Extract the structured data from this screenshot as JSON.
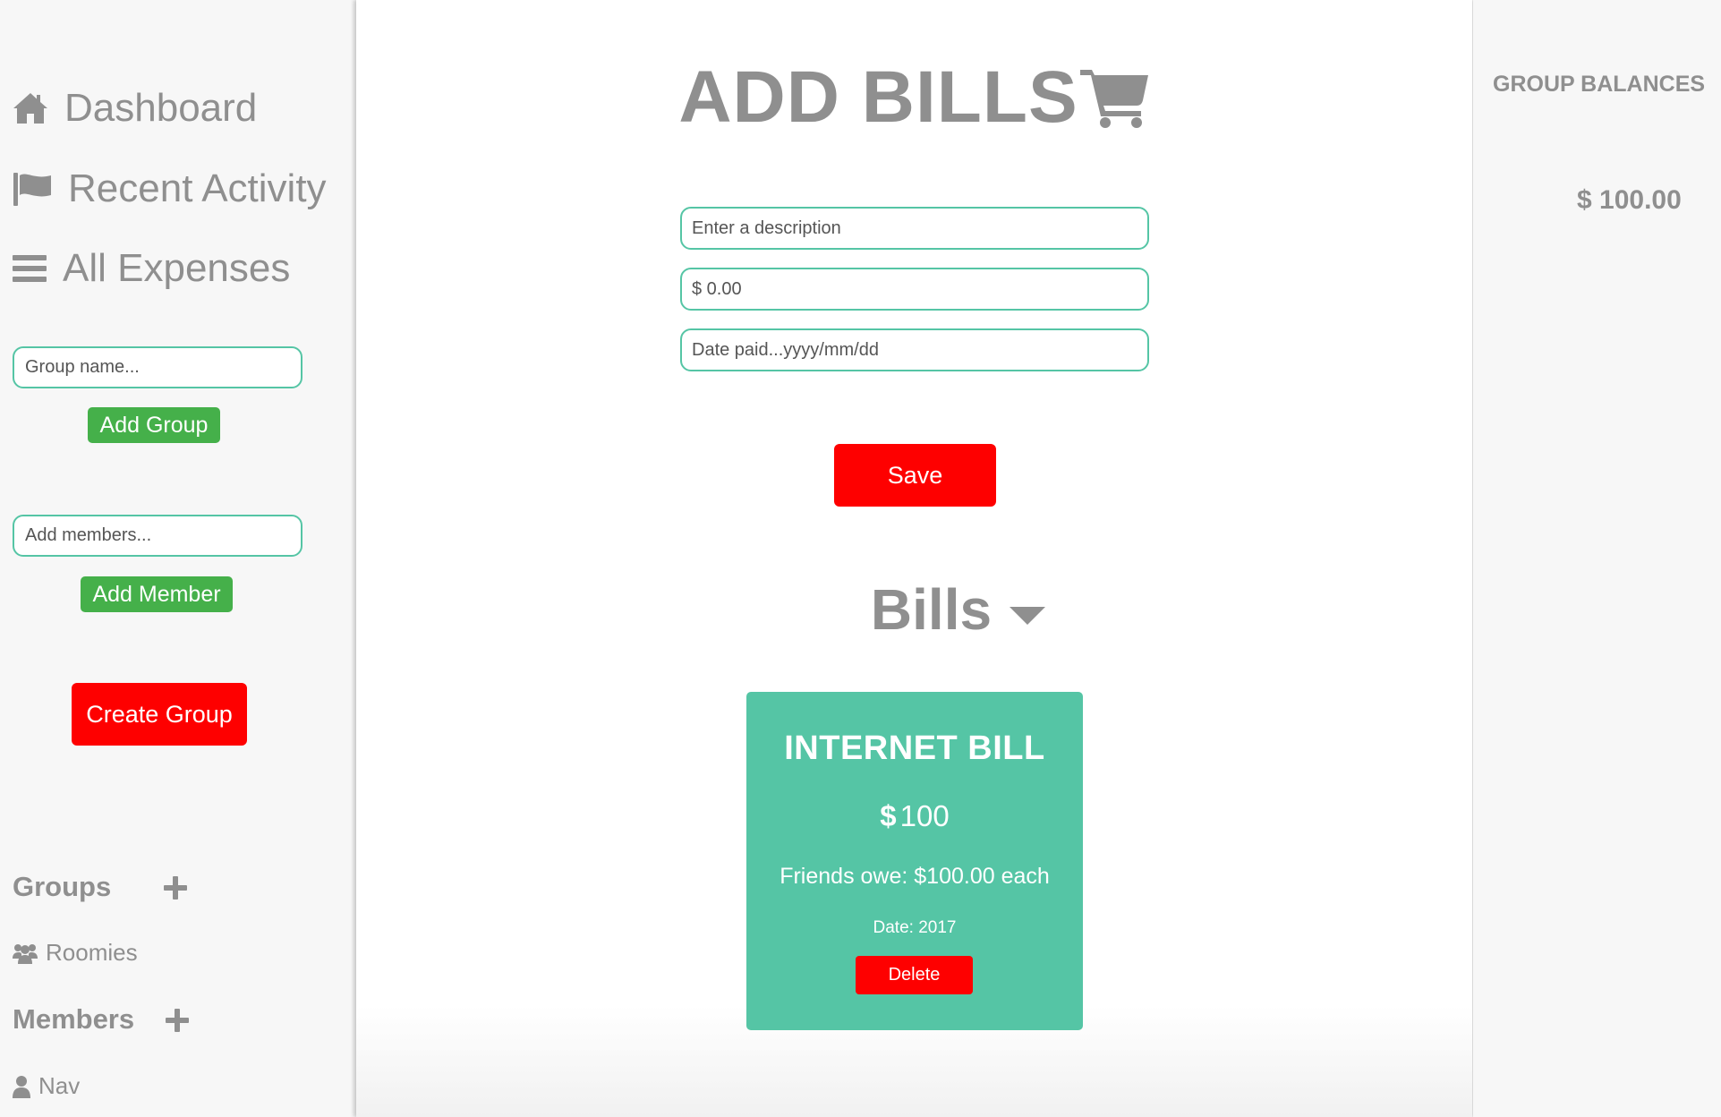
{
  "sidebar": {
    "nav": {
      "dashboard": "Dashboard",
      "recent_activity": "Recent Activity",
      "all_expenses": "All Expenses"
    },
    "group_name_placeholder": "Group name...",
    "add_group_label": "Add Group",
    "add_members_placeholder": "Add members...",
    "add_member_label": "Add Member",
    "create_group_label": "Create Group",
    "groups_heading": "Groups",
    "groups": [
      "Roomies"
    ],
    "members_heading": "Members",
    "members": [
      "Nav"
    ]
  },
  "main": {
    "title": "ADD BILLS",
    "description_placeholder": "Enter a description",
    "amount_placeholder": "$ 0.00",
    "date_placeholder": "Date paid...yyyy/mm/dd",
    "save_label": "Save",
    "bills_heading": "Bills",
    "bills": [
      {
        "name": "INTERNET BILL",
        "currency": "$",
        "amount": "100",
        "owe_text": "Friends owe: $100.00 each",
        "date_text": "Date: 2017",
        "delete_label": "Delete"
      }
    ]
  },
  "right_panel": {
    "title": "GROUP BALANCES",
    "balance": "$ 100.00"
  },
  "colors": {
    "accent_teal": "#55c5a5",
    "button_green": "#45b04a",
    "button_red": "#fe0000",
    "text_gray": "#8f8f8f"
  },
  "icons": {
    "dashboard": "home-icon",
    "recent_activity": "flag-icon",
    "all_expenses": "list-icon",
    "title": "cart-icon",
    "groups_add": "plus-icon",
    "group_item": "users-icon",
    "members_add": "plus-icon",
    "member_item": "user-icon",
    "bills_toggle": "caret-down-icon"
  }
}
